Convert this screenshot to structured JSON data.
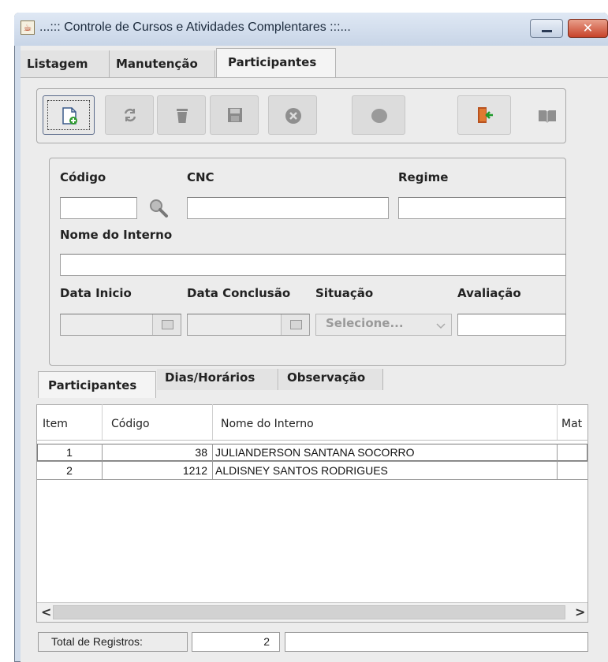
{
  "window": {
    "title": "...::: Controle de Cursos e Atividades Complentares :::...",
    "close_glyph": "✕"
  },
  "main_tabs": [
    {
      "label": "Listagem"
    },
    {
      "label": "Manutenção"
    },
    {
      "label": "Participantes"
    }
  ],
  "toolbar": {
    "buttons": [
      {
        "icon": "new-document-icon",
        "enabled": true
      },
      {
        "icon": "refresh-icon",
        "enabled": false
      },
      {
        "icon": "trash-icon",
        "enabled": false
      },
      {
        "icon": "save-icon",
        "enabled": false
      },
      {
        "icon": "cancel-icon",
        "enabled": false
      },
      {
        "icon": "confirm-icon",
        "enabled": false
      },
      {
        "icon": "exit-door-icon",
        "enabled": true
      },
      {
        "icon": "book-icon",
        "enabled": false
      }
    ]
  },
  "form": {
    "codigo_label": "Código",
    "codigo_value": "",
    "cnc_label": "CNC",
    "cnc_value": "",
    "regime_label": "Regime",
    "regime_value": "",
    "nome_label": "Nome do Interno",
    "nome_value": "",
    "data_inicio_label": "Data Inicio",
    "data_conclusao_label": "Data Conclusão",
    "situacao_label": "Situação",
    "situacao_value": "Selecione...",
    "avaliacao_label": "Avaliação",
    "avaliacao_value": ""
  },
  "sub_tabs": [
    {
      "label": "Participantes"
    },
    {
      "label": "Dias/Horários"
    },
    {
      "label": "Observação"
    }
  ],
  "table": {
    "columns": [
      "Item",
      "Código",
      "Nome do Interno",
      "Mat"
    ],
    "rows": [
      {
        "item": "1",
        "codigo": "38",
        "nome": "JULIANDERSON SANTANA SOCORRO"
      },
      {
        "item": "2",
        "codigo": "1212",
        "nome": "ALDISNEY SANTOS RODRIGUES"
      }
    ],
    "scroll_left": "<",
    "scroll_right": ">"
  },
  "status": {
    "total_label": "Total de Registros:",
    "total_value": "2",
    "extra": ""
  }
}
